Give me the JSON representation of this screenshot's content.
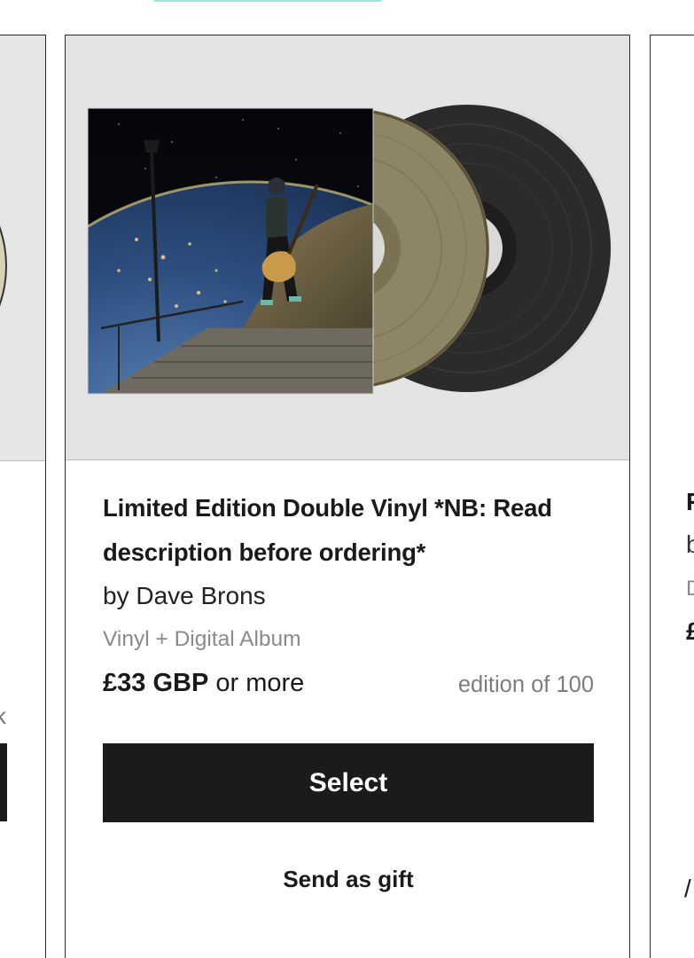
{
  "product": {
    "title": "Limited Edition Double Vinyl *NB: Read description before ordering*",
    "artist": "by Dave Brons",
    "format": "Vinyl + Digital Album",
    "price_amount": "£33 GBP",
    "price_suffix": "or more",
    "edition": "edition of 100",
    "select_label": "Select",
    "gift_label": "Send as gift",
    "image_alt": "Album cover: guitarist on stone steps above Earth at night, with gold and black vinyl records"
  },
  "left_card": {
    "truncated_text": "k"
  },
  "right_card": {
    "truncated_title": "F",
    "truncated_artist": "b",
    "truncated_format": "D",
    "truncated_price": "£",
    "truncated_link": "/"
  },
  "colors": {
    "button_bg": "#1b1b1b",
    "accent": "#9fe1ec",
    "gold_vinyl": "#8e8466",
    "black_vinyl": "#2a2a2a"
  }
}
